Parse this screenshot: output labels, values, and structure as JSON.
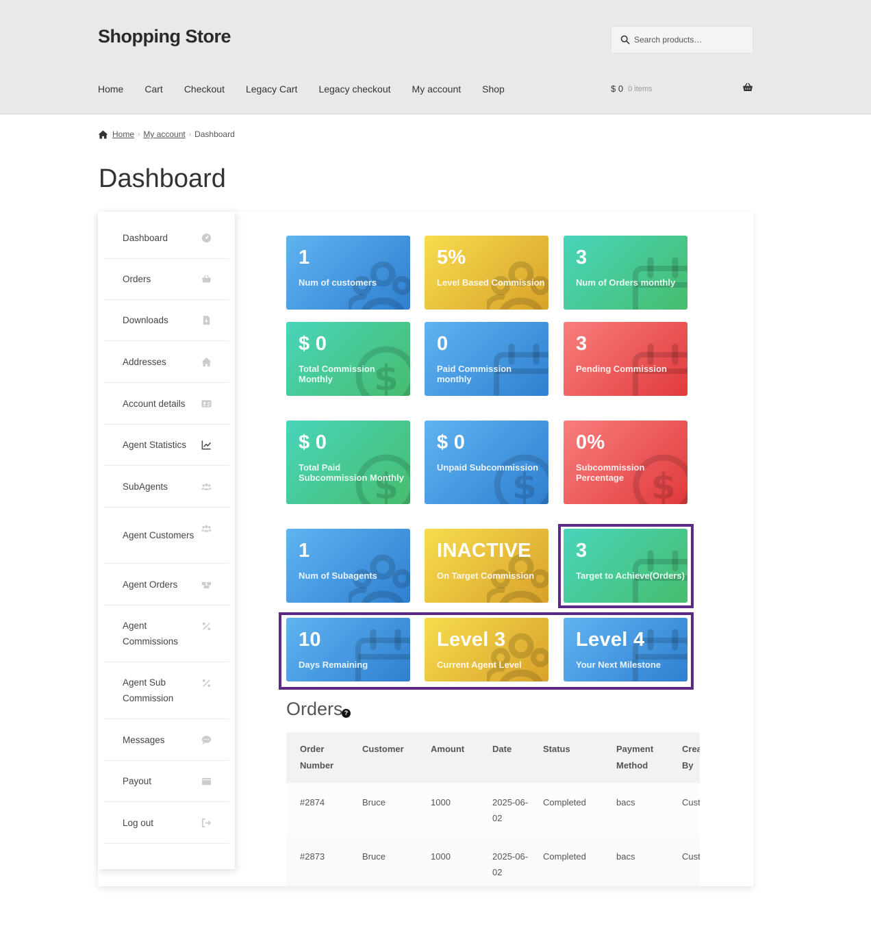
{
  "header": {
    "site_title": "Shopping Store",
    "search_placeholder": "Search products…",
    "nav": [
      "Home",
      "Cart",
      "Checkout",
      "Legacy Cart",
      "Legacy checkout",
      "My account",
      "Shop"
    ],
    "cart_total": "$ 0",
    "cart_items": "0 items"
  },
  "breadcrumb": {
    "home": "Home",
    "account": "My account",
    "current": "Dashboard"
  },
  "page_title": "Dashboard",
  "sidebar": {
    "items": [
      {
        "label": "Dashboard",
        "icon": "dashboard-icon"
      },
      {
        "label": "Orders",
        "icon": "basket-icon"
      },
      {
        "label": "Downloads",
        "icon": "file-download-icon"
      },
      {
        "label": "Addresses",
        "icon": "home-icon"
      },
      {
        "label": "Account details",
        "icon": "id-card-icon"
      },
      {
        "label": "Agent Statistics",
        "icon": "line-chart-icon"
      },
      {
        "label": "SubAgents",
        "icon": "users-icon"
      },
      {
        "label": "Agent Customers",
        "icon": "users-icon"
      },
      {
        "label": "Agent Orders",
        "icon": "boxes-icon"
      },
      {
        "label": "Agent Commissions",
        "icon": "percent-icon"
      },
      {
        "label": "Agent Sub Commission",
        "icon": "percent-icon"
      },
      {
        "label": "Messages",
        "icon": "chat-icon"
      },
      {
        "label": "Payout",
        "icon": "wallet-icon"
      },
      {
        "label": "Log out",
        "icon": "logout-icon"
      }
    ]
  },
  "tiles": [
    {
      "value": "1",
      "label": "Num of customers",
      "color": "blue",
      "icon": "users-icon"
    },
    {
      "value": "5%",
      "label": "Level Based Commission",
      "color": "yellow",
      "icon": "users-icon"
    },
    {
      "value": "3",
      "label": "Num of Orders monthly",
      "color": "green",
      "icon": "calendar-icon"
    },
    {
      "value": "$ 0",
      "label": "Total Commission Monthly",
      "color": "green",
      "icon": "dollar-icon"
    },
    {
      "value": "0",
      "label": "Paid Commission monthly",
      "color": "blue",
      "icon": "calendar-icon"
    },
    {
      "value": "3",
      "label": "Pending Commission",
      "color": "red",
      "icon": "calendar-icon"
    },
    {
      "value": "$ 0",
      "label": "Total Paid Subcommission Monthly",
      "color": "green",
      "icon": "dollar-icon"
    },
    {
      "value": "$ 0",
      "label": "Unpaid Subcommission",
      "color": "blue",
      "icon": "dollar-icon"
    },
    {
      "value": "0%",
      "label": "Subcommission Percentage",
      "color": "red",
      "icon": "dollar-icon"
    },
    {
      "value": "1",
      "label": "Num of Subagents",
      "color": "blue",
      "icon": "users-icon"
    },
    {
      "value": "INACTIVE",
      "label": "On Target Commission",
      "color": "yellow",
      "icon": "users-icon"
    },
    {
      "value": "3",
      "label": "Target to Achieve(Orders)",
      "color": "green",
      "icon": "calendar-icon"
    },
    {
      "value": "10",
      "label": "Days Remaining",
      "color": "blue",
      "icon": "calendar-icon"
    },
    {
      "value": "Level 3",
      "label": "Current Agent Level",
      "color": "yellow",
      "icon": "users-icon"
    },
    {
      "value": "Level 4",
      "label": "Your Next Milestone",
      "color": "blue",
      "icon": "calendar-icon"
    }
  ],
  "orders": {
    "title": "Orders",
    "help": "?",
    "columns": [
      "Order Number",
      "Customer",
      "Amount",
      "Date",
      "Status",
      "Payment Method",
      "Created By"
    ],
    "rows": [
      [
        "#2874",
        "Bruce",
        "1000",
        "2025-06-02",
        "Completed",
        "bacs",
        "Customer"
      ],
      [
        "#2873",
        "Bruce",
        "1000",
        "2025-06-02",
        "Completed",
        "bacs",
        "Customer"
      ]
    ]
  }
}
